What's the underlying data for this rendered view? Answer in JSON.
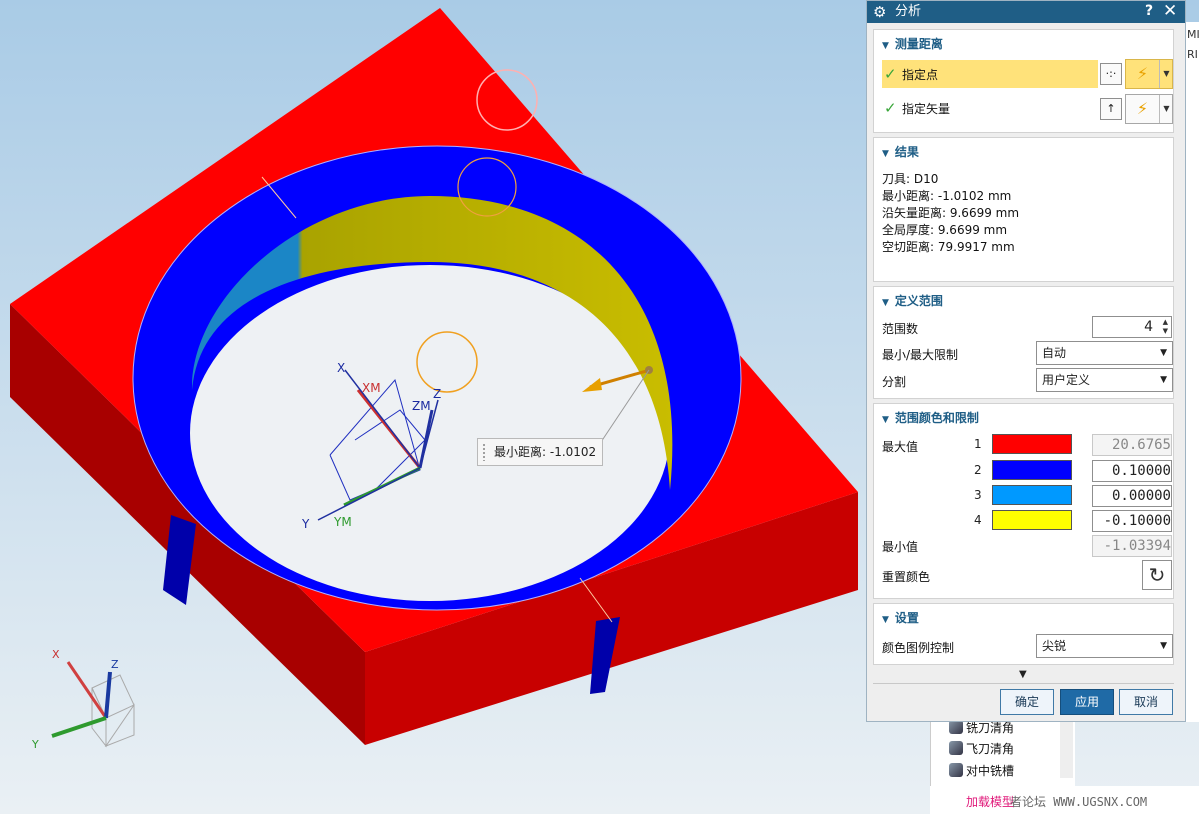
{
  "viewport": {
    "dist_label": "最小距离: -1.0102",
    "axes": {
      "x": "X",
      "y": "Y",
      "z": "Z",
      "xm": "XM",
      "ym": "YM",
      "zm": "ZM"
    },
    "triad": {
      "x": "X",
      "y": "Y",
      "z": "Z"
    },
    "colors": {
      "part_red": "#ff0000",
      "part_dark": "#a80000",
      "ring_blue": "#0000ff",
      "wall_yellow": "#b3a900",
      "wall_cyan": "#1b86c6",
      "background_top": "#a9cbe6",
      "background_bottom": "#e8eef3"
    }
  },
  "background": {
    "right_fragments": [
      "MIL",
      "RI"
    ],
    "nav_tree": [
      "铣刀清角",
      "飞刀清角",
      "对中铣槽"
    ],
    "watermark": "加载模型",
    "watermark_url": "者论坛 WWW.UGSNX.COM"
  },
  "dialog": {
    "title": "分析",
    "help": "?",
    "close": "✕",
    "measure": {
      "header": "测量距离",
      "rows": [
        {
          "label": "指定点"
        },
        {
          "label": "指定矢量"
        }
      ]
    },
    "results": {
      "header": "结果",
      "lines": [
        "刀具: D10",
        "最小距离: -1.0102 mm",
        "沿矢量距离: 9.6699 mm",
        "全局厚度: 9.6699 mm",
        "空切距离: 79.9917 mm"
      ]
    },
    "range": {
      "header": "定义范围",
      "count_label": "范围数",
      "count_value": "4",
      "limit_label": "最小/最大限制",
      "limit_value": "自动",
      "split_label": "分割",
      "split_value": "用户定义"
    },
    "colors": {
      "header": "范围颜色和限制",
      "max_label": "最大值",
      "min_label": "最小值",
      "reset_label": "重置颜色",
      "items": [
        {
          "index": "1",
          "color": "#ff0000",
          "value": "20.6765"
        },
        {
          "index": "2",
          "color": "#0000ff",
          "value": "0.10000"
        },
        {
          "index": "3",
          "color": "#0099ff",
          "value": "0.00000"
        },
        {
          "index": "4",
          "color": "#ffff00",
          "value": "-0.10000"
        }
      ],
      "min_value": "-1.03394"
    },
    "settings": {
      "header": "设置",
      "legend_label": "颜色图例控制",
      "legend_value": "尖锐"
    },
    "buttons": {
      "ok": "确定",
      "apply": "应用",
      "cancel": "取消"
    }
  }
}
